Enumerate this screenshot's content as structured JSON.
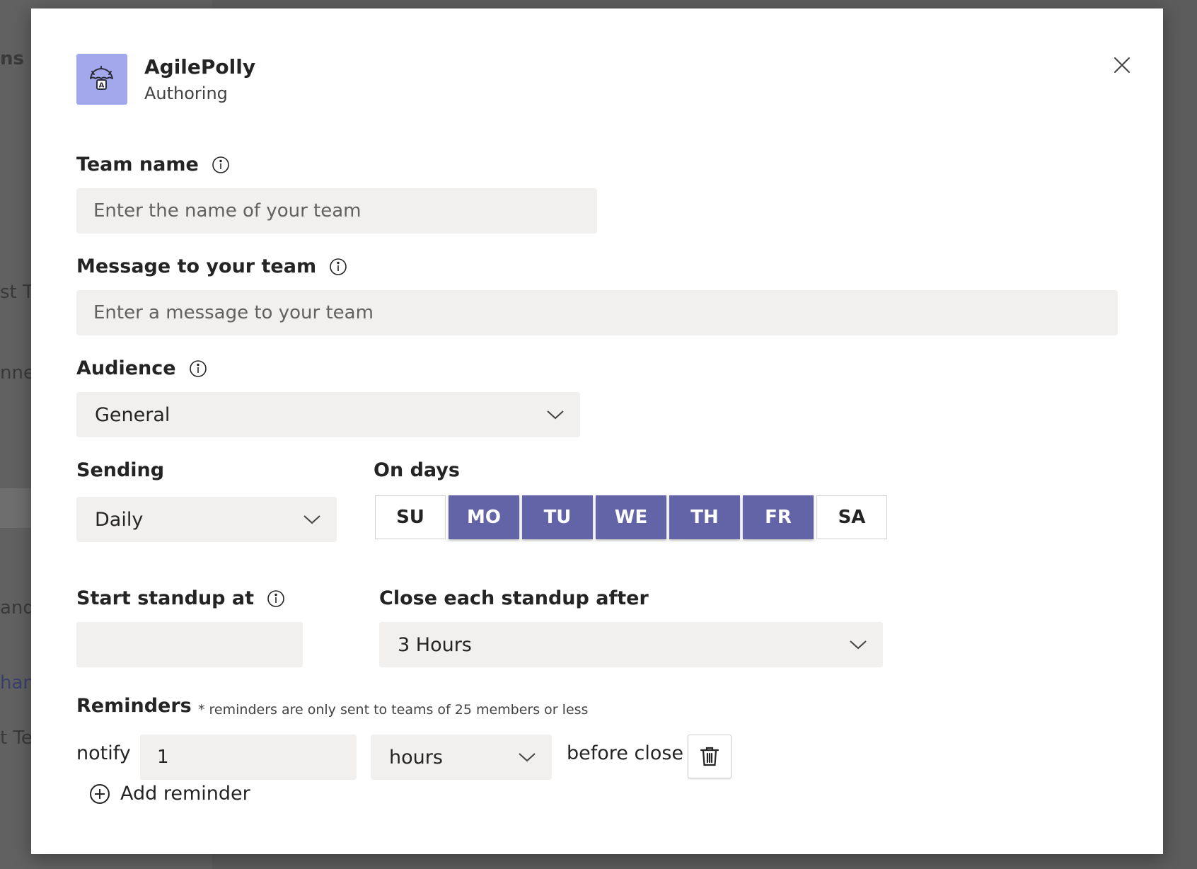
{
  "background": {
    "snippets": [
      "ns En",
      "st Te",
      "nne",
      "and",
      "hann",
      "t Te"
    ]
  },
  "dialog": {
    "app_name": "AgilePolly",
    "app_subtitle": "Authoring",
    "logo_icon": "umbrella-robot-icon",
    "close_icon": "close-icon"
  },
  "form": {
    "team_name": {
      "label": "Team name",
      "placeholder": "Enter the name of your team",
      "value": ""
    },
    "message": {
      "label": "Message to your team",
      "placeholder": "Enter a message to your team",
      "value": ""
    },
    "audience": {
      "label": "Audience",
      "value": "General"
    },
    "sending": {
      "label": "Sending",
      "value": "Daily"
    },
    "on_days": {
      "label": "On days",
      "days": [
        {
          "label": "SU",
          "selected": false
        },
        {
          "label": "MO",
          "selected": true
        },
        {
          "label": "TU",
          "selected": true
        },
        {
          "label": "WE",
          "selected": true
        },
        {
          "label": "TH",
          "selected": true
        },
        {
          "label": "FR",
          "selected": true
        },
        {
          "label": "SA",
          "selected": false
        }
      ]
    },
    "start_standup": {
      "label": "Start standup at",
      "value": ""
    },
    "close_after": {
      "label": "Close each standup after",
      "value": "3 Hours"
    },
    "reminders": {
      "label": "Reminders",
      "note": "* reminders are only sent to teams of 25 members or less",
      "notify_label": "notify",
      "amount": "1",
      "unit": "hours",
      "suffix": "before close",
      "add_label": "Add reminder"
    }
  },
  "colors": {
    "accent": "#6264a7",
    "logo_bg": "#a3a7ec",
    "field_bg": "#f1f0ef"
  }
}
